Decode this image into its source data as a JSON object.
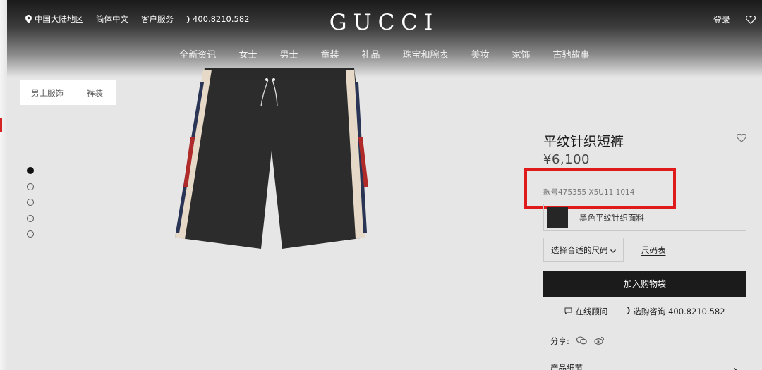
{
  "header": {
    "region": "中国大陆地区",
    "language": "简体中文",
    "service": "客户服务",
    "phone": "400.8210.582",
    "logo": "GUCCI",
    "login": "登录"
  },
  "nav": {
    "items": [
      "全新资讯",
      "女士",
      "男士",
      "童装",
      "礼品",
      "珠宝和腕表",
      "美妆",
      "家饰",
      "古驰故事"
    ]
  },
  "breadcrumb": {
    "items": [
      "男士服饰",
      "裤装"
    ]
  },
  "gallery": {
    "dot_count": 5,
    "active_index": 0
  },
  "product": {
    "title": "平纹针织短裤",
    "price": "¥6,100",
    "sku": "款号475355 X5U11 1014",
    "color_label": "黑色平纹针织面料",
    "size_placeholder": "选择合适的尺码",
    "size_guide": "尺码表",
    "add_to_bag": "加入购物袋",
    "online_advisor": "在线顾问",
    "purchase_consult": "选购咨询 400.8210.582",
    "share_label": "分享:",
    "details_label": "产品细节"
  },
  "colors": {
    "highlight": "#e01a1a",
    "swatch": "#262626",
    "button": "#1b1b1b"
  },
  "icons": [
    "location-pin-icon",
    "phone-icon",
    "heart-icon",
    "chevron-down-icon",
    "chat-icon",
    "wechat-icon",
    "weibo-icon",
    "chevron-right-icon"
  ]
}
